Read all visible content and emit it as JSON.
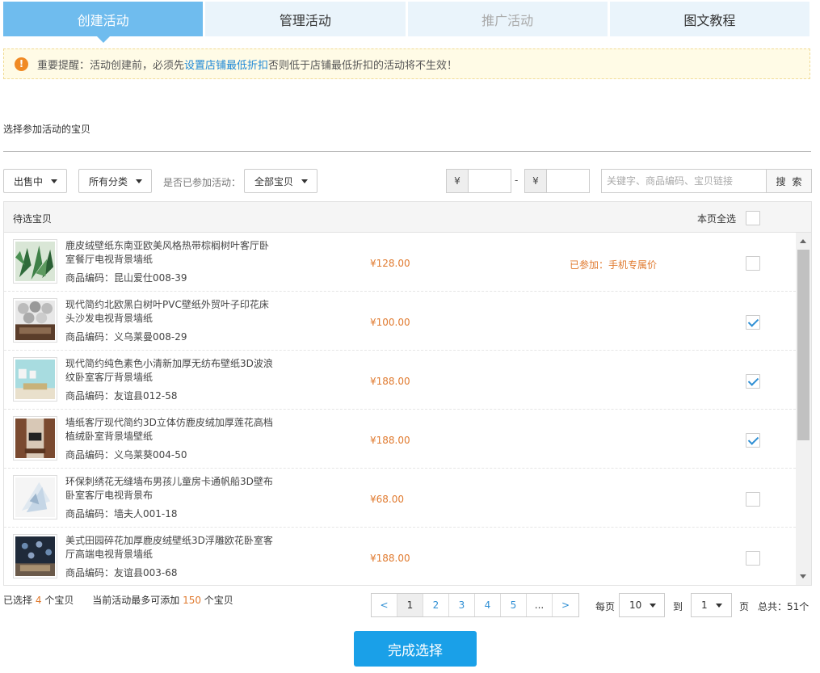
{
  "tabs": [
    {
      "label": "创建活动",
      "state": "active"
    },
    {
      "label": "管理活动",
      "state": "normal"
    },
    {
      "label": "推广活动",
      "state": "disabled"
    },
    {
      "label": "图文教程",
      "state": "normal"
    }
  ],
  "notice": {
    "icon": "!",
    "prefix": "重要提醒：活动创建前，必须先",
    "link": "设置店铺最低折扣",
    "suffix": "否则低于店铺最低折扣的活动将不生效！"
  },
  "section_title": "选择参加活动的宝贝",
  "filters": {
    "status": "出售中",
    "category": "所有分类",
    "joined_label": "是否已参加活动：",
    "joined_value": "全部宝贝",
    "currency": "¥",
    "dash": "-",
    "search_placeholder": "关键字、商品编码、宝贝链接",
    "search_button": "搜索"
  },
  "table": {
    "header_left": "待选宝贝",
    "header_right": "本页全选",
    "rows": [
      {
        "title": "鹿皮绒壁纸东南亚欧美风格热带棕榈树叶客厅卧室餐厅电视背景墙纸",
        "code": "商品编码：昆山爱仕008-39",
        "price": "¥128.00",
        "joined": "已参加：手机专属价",
        "checked": false
      },
      {
        "title": "现代简约北欧黑白树叶PVC壁纸外贸叶子印花床头沙发电视背景墙纸",
        "code": "商品编码：义乌莱曼008-29",
        "price": "¥100.00",
        "joined": "",
        "checked": true
      },
      {
        "title": "现代简约纯色素色小清新加厚无纺布壁纸3D波浪纹卧室客厅背景墙纸",
        "code": "商品编码：友谊县012-58",
        "price": "¥188.00",
        "joined": "",
        "checked": true
      },
      {
        "title": "墙纸客厅现代简约3D立体仿鹿皮绒加厚莲花高档植绒卧室背景墙壁纸",
        "code": "商品编码：义乌莱葵004-50",
        "price": "¥188.00",
        "joined": "",
        "checked": true
      },
      {
        "title": "环保刺绣花无缝墙布男孩儿童房卡通帆船3D壁布卧室客厅电视背景布",
        "code": "商品编码：墙夫人001-18",
        "price": "¥68.00",
        "joined": "",
        "checked": false
      },
      {
        "title": "美式田园碎花加厚鹿皮绒壁纸3D浮雕欧花卧室客厅高端电视背景墙纸",
        "code": "商品编码：友谊县003-68",
        "price": "¥188.00",
        "joined": "",
        "checked": false
      }
    ]
  },
  "footer": {
    "selected_prefix": "已选择",
    "selected_count": "4",
    "selected_suffix": "个宝贝",
    "max_prefix": "当前活动最多可添加",
    "max_count": "150",
    "max_suffix": "个宝贝",
    "pages": [
      "<",
      "1",
      "2",
      "3",
      "4",
      "5",
      "...",
      ">"
    ],
    "active_page": "1",
    "per_page_label": "每页",
    "per_page_value": "10",
    "goto_label": "到",
    "goto_value": "1",
    "page_unit": "页",
    "total": "总共：51个"
  },
  "done_button": "完成选择",
  "colors": {
    "tab_active": "#6fbcee",
    "tab_normal": "#eaf4fb",
    "accent_orange": "#e07a2f",
    "link_blue": "#1e88d6",
    "button_blue": "#1aa0e8"
  }
}
